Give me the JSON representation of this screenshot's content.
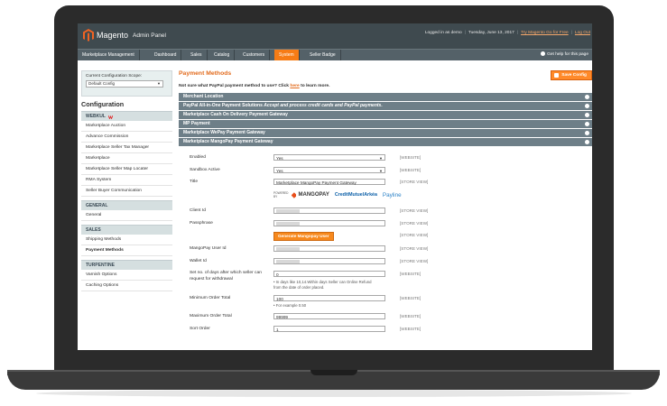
{
  "app": {
    "logo_text": "Magento",
    "logo_sub": "Admin Panel",
    "header": {
      "logged_in": "Logged in as demo",
      "date": "Tuesday, June 13, 2017",
      "try_link": "Try Magento Go for Free",
      "logout": "Log Out"
    },
    "nav": [
      "Marketplace Management",
      "Dashboard",
      "Sales",
      "Catalog",
      "Customers",
      "System",
      "Seller Badge"
    ],
    "nav_active": "System",
    "help": "Get help for this page"
  },
  "sidebar": {
    "scope_label": "Current Configuration Scope:",
    "scope_value": "Default Config",
    "title": "Configuration",
    "sections": [
      {
        "head": "WEBKUL",
        "items": [
          "Marketplace Auction",
          "Advance Commission",
          "Marketplace Seller Tax Manager",
          "Marketplace",
          "Marketplace Seller Map Locater",
          "RMA System",
          "Seller Buyer Communication"
        ]
      },
      {
        "head": "GENERAL",
        "items": [
          "General"
        ]
      },
      {
        "head": "SALES",
        "items": [
          "Shipping Methods",
          "Payment Methods"
        ]
      },
      {
        "head": "TURPENTINE",
        "items": [
          "Varnish Options",
          "Caching Options"
        ]
      }
    ],
    "active_item": "Payment Methods"
  },
  "main": {
    "title": "Payment Methods",
    "save_label": "Save Config",
    "notice": "Not sure what PayPal payment method to use? Click ",
    "notice_link": "here",
    "notice_end": " to learn more.",
    "groups": [
      "Merchant Location",
      "PayPal All-in-One Payment Solutions",
      "Marketplace Cash On Delivery Payment Gateway",
      "MP Payment",
      "Marketplace WePay Payment Gateway",
      "Marketplace MangoPay Payment Gateway"
    ],
    "group_desc": "Accept and process credit cards and PayPal payments.",
    "form": {
      "enabled_label": "Enabled",
      "enabled_value": "Yes",
      "enabled_scope": "[WEBSITE]",
      "sandbox_label": "Sandbox Active",
      "sandbox_value": "Yes",
      "sandbox_scope": "[WEBSITE]",
      "title_label": "Title",
      "title_value": "Marketplace MangoPay Payment Gateway",
      "title_scope": "[STORE VIEW]",
      "logo_powered": "POWERED BY",
      "logo_mangopay": "MANGOPAY",
      "logo_cm": "CreditMutuelArkéa",
      "logo_payline": "Payline",
      "client_label": "Client Id",
      "client_scope": "[STORE VIEW]",
      "pass_label": "Passphrase",
      "pass_scope": "[STORE VIEW]",
      "gen_btn": "Generate Mangopay User",
      "gen_scope": "[STORE VIEW]",
      "uid_label": "MangoPay User Id",
      "uid_scope": "[STORE VIEW]",
      "wallet_label": "Wallet Id",
      "wallet_scope": "[STORE VIEW]",
      "days_label": "Set no. of days after which seller can request for withdrawal",
      "days_value": "0",
      "days_note": "In days like 10,14.Within days Seller can Online Refund from the date of order placed.",
      "days_scope": "[WEBSITE]",
      "min_label": "Minimum Order Total",
      "min_value": "100",
      "min_note": "For example 0.50",
      "min_scope": "[WEBSITE]",
      "max_label": "Maximum Order Total",
      "max_value": "99999",
      "max_scope": "[WEBSITE]",
      "sort_label": "Sort Order",
      "sort_value": "1",
      "sort_scope": "[WEBSITE]"
    }
  },
  "colors": {
    "accent": "#f77c16",
    "header": "#3f4a4f",
    "group": "#6e7f88"
  }
}
